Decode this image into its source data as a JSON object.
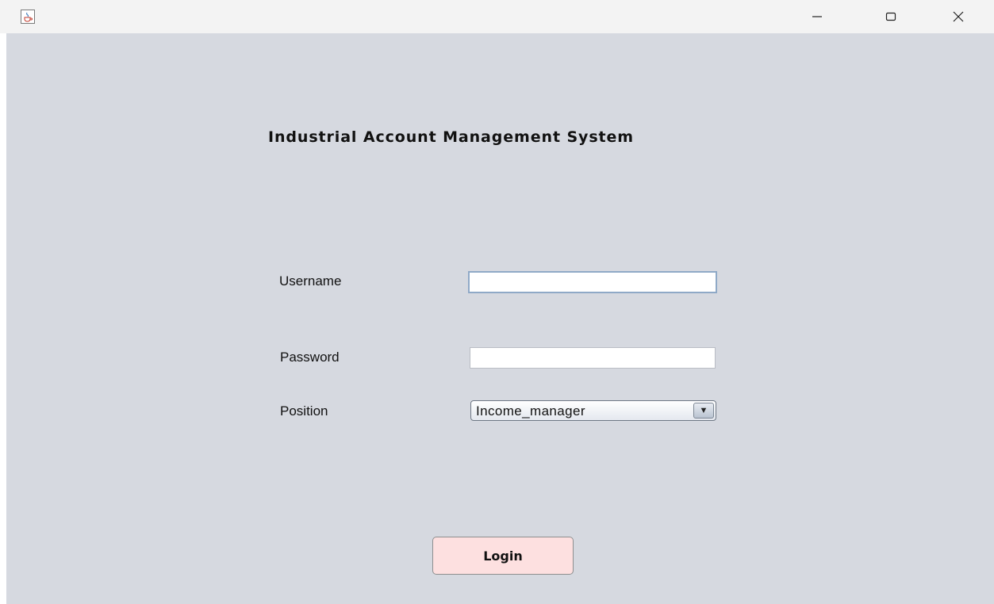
{
  "window": {
    "app_icon": "java-cup-icon",
    "controls": {
      "minimize_icon": "minimize-icon",
      "maximize_icon": "maximize-icon",
      "close_icon": "close-icon"
    }
  },
  "form": {
    "title": "Industrial Account Management System",
    "username_label": "Username",
    "username_value": "",
    "password_label": "Password",
    "password_value": "",
    "position_label": "Position",
    "position_value": "Income_manager",
    "login_label": "Login"
  },
  "colors": {
    "background": "#d6d9e0",
    "login_button": "#fde0e0",
    "focus_border": "#8fa9c7"
  }
}
